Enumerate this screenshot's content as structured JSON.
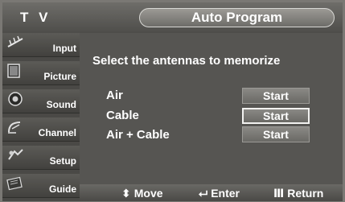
{
  "header": {
    "tv_label": "T V",
    "title": "Auto Program"
  },
  "sidebar": {
    "items": [
      {
        "label": "Input",
        "icon": "antenna-icon"
      },
      {
        "label": "Picture",
        "icon": "picture-icon"
      },
      {
        "label": "Sound",
        "icon": "speaker-icon"
      },
      {
        "label": "Channel",
        "icon": "satellite-dish-icon"
      },
      {
        "label": "Setup",
        "icon": "setup-icon"
      },
      {
        "label": "Guide",
        "icon": "guide-icon"
      }
    ]
  },
  "content": {
    "prompt": "Select the antennas to memorize",
    "options": [
      {
        "label": "Air",
        "button": "Start",
        "selected": false
      },
      {
        "label": "Cable",
        "button": "Start",
        "selected": true
      },
      {
        "label": "Air + Cable",
        "button": "Start",
        "selected": false
      }
    ]
  },
  "footer": {
    "move": "Move",
    "enter": "Enter",
    "return": "Return"
  },
  "colors": {
    "background": "#575653",
    "text": "#ffffff",
    "selected_border": "#f2f2f0"
  }
}
